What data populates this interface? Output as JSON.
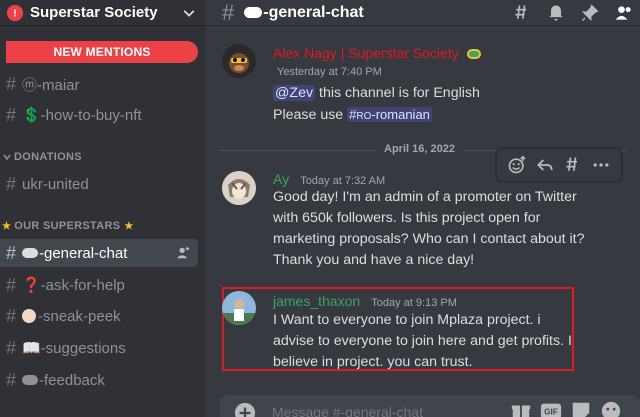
{
  "server": {
    "name": "Superstar Society"
  },
  "sidebar": {
    "new_mentions": "NEW MENTIONS",
    "channels_top": [
      {
        "label": "ⓜ-maiar"
      },
      {
        "label": "💲-how-to-buy-nft"
      }
    ],
    "category_donations": "DONATIONS",
    "donations_channels": [
      {
        "label": "ukr-united"
      }
    ],
    "category_superstars": "OUR SUPERSTARS",
    "superstar_channels": [
      {
        "label": "-general-chat",
        "active": true
      },
      {
        "label": "❓-ask-for-help"
      },
      {
        "label": "-sneak-peek"
      },
      {
        "label": "📖-suggestions"
      },
      {
        "label": "-feedback"
      }
    ]
  },
  "channel": {
    "name": "-general-chat"
  },
  "messages": [
    {
      "author": "Alex Nagy | Superstar Society",
      "author_color": "#e01b24",
      "timestamp": "Yesterday at 7:40 PM",
      "mention": "@Zev",
      "line1_rest": " this channel is for English",
      "line2_prefix": "Please use ",
      "channel_link": "#RO-romanian"
    },
    {
      "divider": "April 16, 2022"
    },
    {
      "author": "Ay",
      "author_color": "#3ba55c",
      "timestamp": "Today at 7:32 AM",
      "lines": [
        "Good day! I'm an admin of a promoter on Twitter",
        "with 650k followers. Is this project open for",
        "marketing proposals? Who can I contact about it?",
        "Thank you and have a nice day!"
      ]
    },
    {
      "author": "james_thaxon",
      "author_color": "#3ba55c",
      "timestamp": "Today at 9:13 PM",
      "lines": [
        "I Want to everyone to join Mplaza  project. i",
        "advise to everyone to join here and get profits. I",
        "believe in  project. you can trust."
      ]
    }
  ],
  "composer": {
    "placeholder": "Message #-general-chat"
  },
  "colors": {
    "sidebar_bg": "#2f3136",
    "main_bg": "#36393f",
    "mention_red": "#ed4245",
    "highlight_border": "#e01b24"
  },
  "icons": [
    "server-icon",
    "chevron-down-icon",
    "hash-icon",
    "add-user-icon",
    "threads-icon",
    "bell-icon",
    "pin-icon",
    "members-icon",
    "add-reaction-icon",
    "reply-icon",
    "create-thread-icon",
    "more-icon",
    "plus-circle-icon",
    "gift-icon",
    "gif-icon",
    "sticker-icon",
    "emoji-icon"
  ]
}
